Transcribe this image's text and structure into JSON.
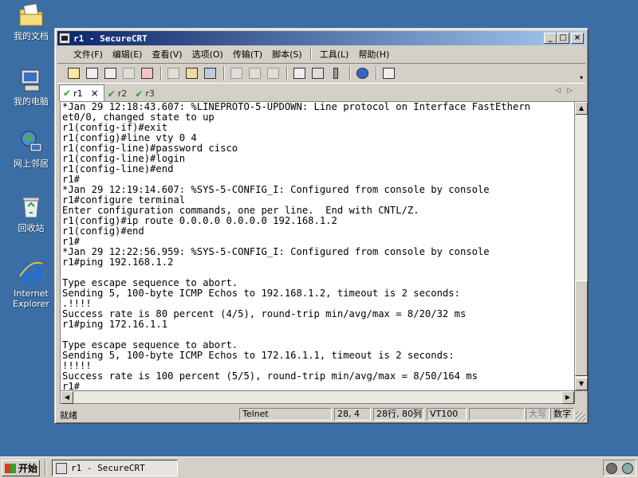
{
  "desktop": {
    "icons": [
      {
        "label": "我的文档",
        "icon": "my-documents-icon"
      },
      {
        "label": "我的电脑",
        "icon": "my-computer-icon"
      },
      {
        "label": "网上邻居",
        "icon": "network-places-icon"
      },
      {
        "label": "回收站",
        "icon": "recycle-bin-icon"
      },
      {
        "label": "Internet Explorer",
        "icon": "internet-explorer-icon"
      }
    ]
  },
  "window": {
    "title": "r1 - SecureCRT",
    "menu": [
      "文件(F)",
      "编辑(E)",
      "查看(V)",
      "选项(O)",
      "传输(T)",
      "脚本(S)",
      "工具(L)",
      "帮助(H)"
    ],
    "tabs": [
      {
        "label": "r1",
        "active": true
      },
      {
        "label": "r2",
        "active": false
      },
      {
        "label": "r3",
        "active": false
      }
    ],
    "tab_close": "×",
    "terminal_lines": [
      "*Jan 29 12:18:43.607: %LINEPROTO-5-UPDOWN: Line protocol on Interface FastEthern",
      "et0/0, changed state to up",
      "r1(config-if)#exit",
      "r1(config)#line vty 0 4",
      "r1(config-line)#password cisco",
      "r1(config-line)#login",
      "r1(config-line)#end",
      "r1#",
      "*Jan 29 12:19:14.607: %SYS-5-CONFIG_I: Configured from console by console",
      "r1#configure terminal",
      "Enter configuration commands, one per line.  End with CNTL/Z.",
      "r1(config)#ip route 0.0.0.0 0.0.0.0 192.168.1.2",
      "r1(config)#end",
      "r1#",
      "*Jan 29 12:22:56.959: %SYS-5-CONFIG_I: Configured from console by console",
      "r1#ping 192.168.1.2",
      "",
      "Type escape sequence to abort.",
      "Sending 5, 100-byte ICMP Echos to 192.168.1.2, timeout is 2 seconds:",
      ".!!!!",
      "Success rate is 80 percent (4/5), round-trip min/avg/max = 8/20/32 ms",
      "r1#ping 172.16.1.1",
      "",
      "Type escape sequence to abort.",
      "Sending 5, 100-byte ICMP Echos to 172.16.1.1, timeout is 2 seconds:",
      "!!!!!",
      "Success rate is 100 percent (5/5), round-trip min/avg/max = 8/50/164 ms",
      "r1#"
    ],
    "status": {
      "ready": "就绪",
      "protocol": "Telnet",
      "cursor": "28,  4",
      "size": "28行, 80列",
      "emulation": "VT100",
      "caps": "大写",
      "num": "数字"
    }
  },
  "taskbar": {
    "start_label": "开始",
    "task_label": "r1 - SecureCRT"
  }
}
